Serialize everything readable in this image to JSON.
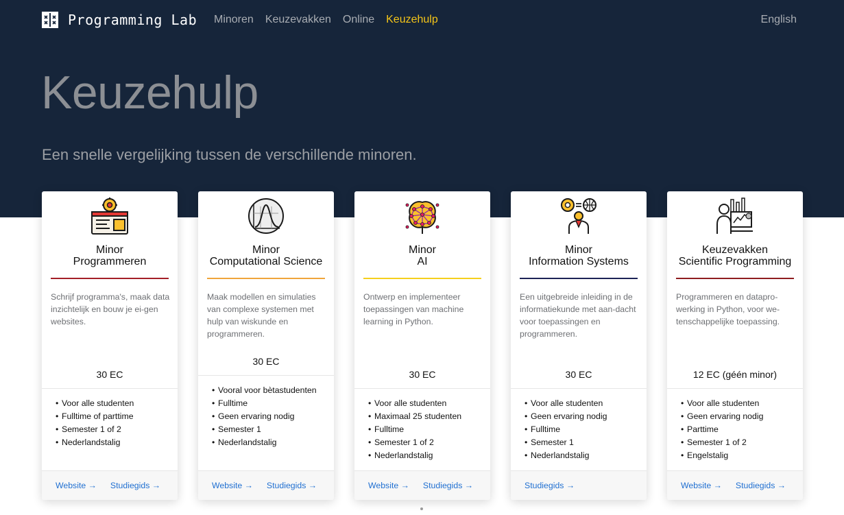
{
  "nav": {
    "brand": "Programming Lab",
    "links": [
      "Minoren",
      "Keuzevakken",
      "Online",
      "Keuzehulp"
    ],
    "language": "English"
  },
  "hero": {
    "title": "Keuzehulp",
    "subtitle": "Een snelle vergelijking tussen de verschillende minoren."
  },
  "cards": [
    {
      "title_line1": "Minor",
      "title_line2": "Programmeren",
      "description": "Schrijf programma's, maak data inzichtelijk en bouw je ei-gen websites.",
      "ec": "30 EC",
      "features": [
        "Voor alle studenten",
        "Fulltime of parttime",
        "Semester 1 of 2",
        "Nederlandstalig"
      ],
      "links": [
        "Website →",
        "Studiegids →"
      ],
      "accent": "#a31f27"
    },
    {
      "title_line1": "Minor",
      "title_line2": "Computational Science",
      "description": "Maak modellen en simulaties van complexe systemen met hulp van wiskunde en programmeren.",
      "ec": "30 EC",
      "features": [
        "Vooral voor bètastudenten",
        "Fulltime",
        "Geen ervaring nodig",
        "Semester 1",
        "Nederlandstalig"
      ],
      "links": [
        "Website →",
        "Studiegids →"
      ],
      "accent": "#f0a43a"
    },
    {
      "title_line1": "Minor",
      "title_line2": "AI",
      "description": "Ontwerp en implementeer toepassingen van machine learning in Python.",
      "ec": "30 EC",
      "features": [
        "Voor alle studenten",
        "Maximaal 25 studenten",
        "Fulltime",
        "Semester 1 of 2",
        "Nederlandstalig"
      ],
      "links": [
        "Website →",
        "Studiegids →"
      ],
      "accent": "#f5cf1d"
    },
    {
      "title_line1": "Minor",
      "title_line2": "Information Systems",
      "description": "Een uitgebreide inleiding in de informatiekunde met aan-dacht voor toepassingen en programmeren.",
      "ec": "30 EC",
      "features": [
        "Voor alle studenten",
        "Geen ervaring nodig",
        "Fulltime",
        "Semester 1",
        "Nederlandstalig"
      ],
      "links": [
        "Studiegids →"
      ],
      "accent": "#1c2255"
    },
    {
      "title_line1": "Keuzevakken",
      "title_line2": "Scientific Programming",
      "description": "Programmeren en datapro-werking in Python, voor we-tenschappelijke toepassing.",
      "ec": "12 EC (géén minor)",
      "features": [
        "Voor alle studenten",
        "Geen ervaring nodig",
        "Parttime",
        "Semester 1 of 2",
        "Engelstalig"
      ],
      "links": [
        "Website →",
        "Studiegids →"
      ],
      "accent": "#8e1d20"
    }
  ]
}
